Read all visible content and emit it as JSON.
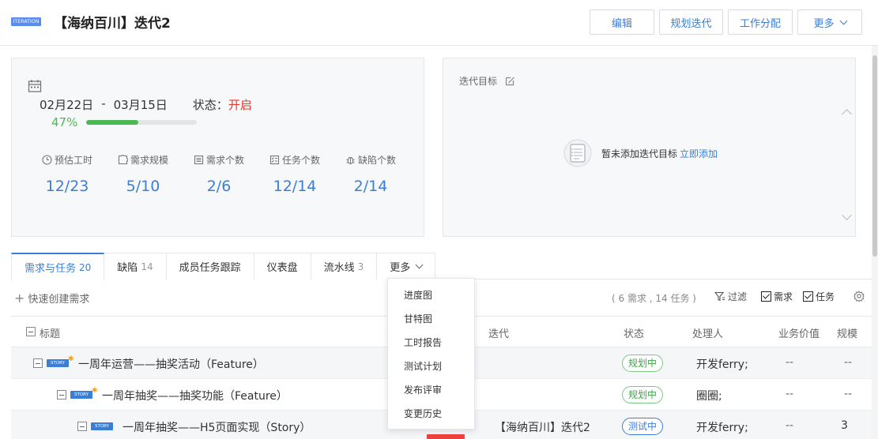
{
  "header": {
    "badge": "ITERATION",
    "title": "【海纳百川】迭代2",
    "buttons": {
      "edit": "编辑",
      "plan": "规划迭代",
      "assign": "工作分配",
      "more": "更多"
    }
  },
  "summary": {
    "start_date": "02月22日",
    "separator": "-",
    "end_date": "03月15日",
    "status_label": "状态：",
    "status_value": "开启",
    "progress_text": "47%",
    "progress_value": 0.47,
    "stats": [
      {
        "icon": "clock-icon",
        "label": "预估工时",
        "value": "12/23"
      },
      {
        "icon": "puzzle-icon",
        "label": "需求规模",
        "value": "5/10"
      },
      {
        "icon": "list-icon",
        "label": "需求个数",
        "value": "2/6"
      },
      {
        "icon": "checklist-icon",
        "label": "任务个数",
        "value": "12/14"
      },
      {
        "icon": "bug-icon",
        "label": "缺陷个数",
        "value": "2/14"
      }
    ]
  },
  "goal": {
    "label": "迭代目标",
    "empty_text": "暂未添加迭代目标",
    "add_link": "立即添加"
  },
  "tabs": [
    {
      "label": "需求与任务",
      "count": "20",
      "active": true
    },
    {
      "label": "缺陷",
      "count": "14"
    },
    {
      "label": "成员任务跟踪",
      "count": ""
    },
    {
      "label": "仪表盘",
      "count": ""
    },
    {
      "label": "流水线",
      "count": "3"
    },
    {
      "label": "更多",
      "count": ""
    }
  ],
  "toolbar": {
    "quick_create": "快速创建需求",
    "counts": "( 6 需求 , 14 任务 )",
    "filter": "过滤",
    "check_req": "需求",
    "check_task": "任务"
  },
  "table": {
    "headers": {
      "title": "标题",
      "iteration": "迭代",
      "status": "状态",
      "assignee": "处理人",
      "value": "业务价值",
      "size": "规模"
    },
    "rows": [
      {
        "title": "一周年运营——抽奖活动（Feature）",
        "badge": "STORY",
        "iteration": "",
        "status": "规划中",
        "status_color": "green",
        "assignee": "开发ferry;",
        "value": "--",
        "size": "--"
      },
      {
        "title": "一周年抽奖——抽奖功能（Feature）",
        "badge": "STORY",
        "iteration": "",
        "status": "规划中",
        "status_color": "green",
        "assignee": "圈圈;",
        "value": "--",
        "size": "--"
      },
      {
        "title": "一周年抽奖——H5页面实现（Story）",
        "badge": "STORY",
        "iteration": "【海纳百川】迭代2",
        "status": "测试中",
        "status_color": "blue",
        "assignee": "开发ferry;",
        "value": "--",
        "size": "3"
      }
    ]
  },
  "dropdown": {
    "items": [
      "进度图",
      "甘特图",
      "工时报告",
      "测试计划",
      "发布评审",
      "变更历史"
    ]
  },
  "colors": {
    "accent": "#3a7ed8",
    "progress": "#4cba54",
    "status_open": "#e23b2e"
  }
}
